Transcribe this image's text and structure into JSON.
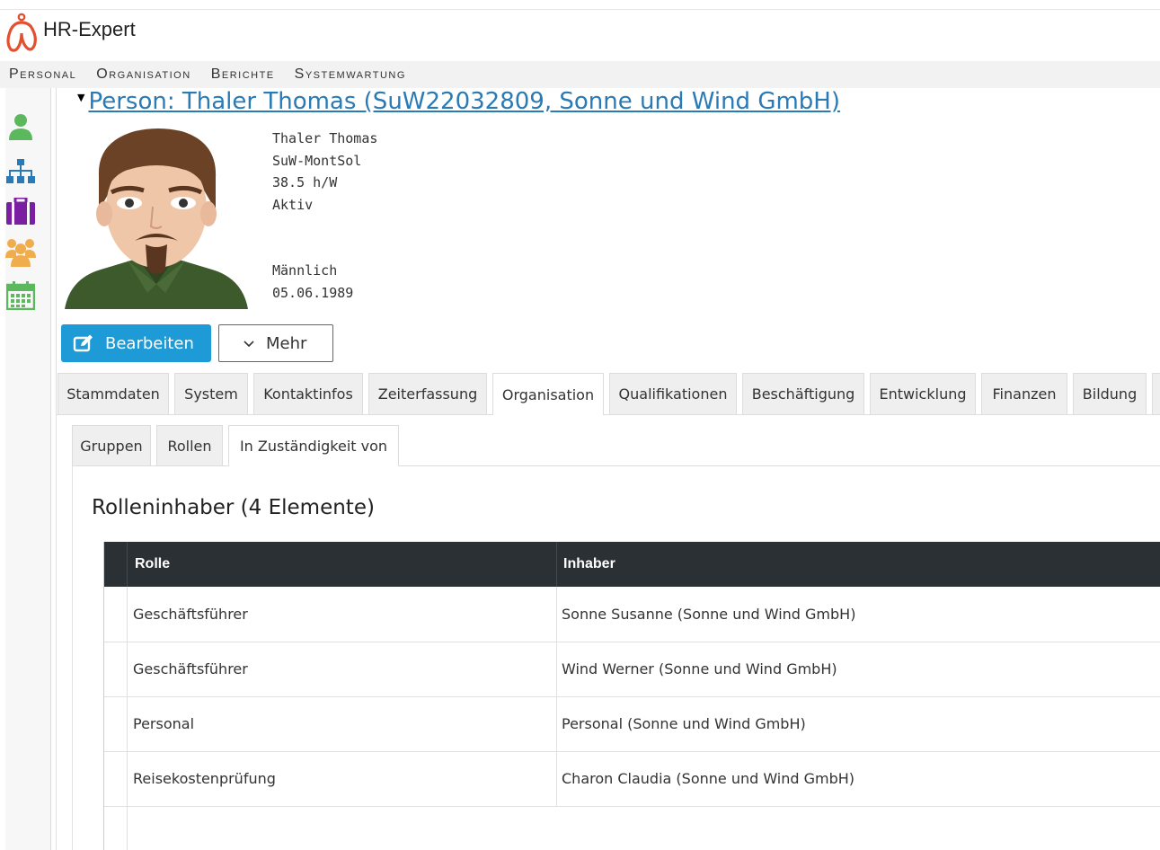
{
  "app": {
    "name": "HR-Expert"
  },
  "menu": [
    {
      "label": "Personal"
    },
    {
      "label": "Organisation"
    },
    {
      "label": "Berichte"
    },
    {
      "label": "Systemwartung"
    }
  ],
  "sidebar": {
    "icons": [
      {
        "name": "user-icon",
        "color": "#5cb85c"
      },
      {
        "name": "org-chart-icon",
        "color": "#2a7ab5"
      },
      {
        "name": "briefcase-icon",
        "color": "#7b1fa2"
      },
      {
        "name": "group-icon",
        "color": "#f0ad4e"
      },
      {
        "name": "calendar-icon",
        "color": "#5cb85c"
      }
    ]
  },
  "person": {
    "title": "Person: Thaler Thomas (SuW22032809, Sonne und Wind GmbH)",
    "name": "Thaler Thomas",
    "unit": "SuW-MontSol",
    "hours": "38.5 h/W",
    "status": "Aktiv",
    "gender": "Männlich",
    "birthdate": "05.06.1989"
  },
  "actions": {
    "edit_label": "Bearbeiten",
    "more_label": "Mehr"
  },
  "tabs": [
    {
      "label": "Stammdaten"
    },
    {
      "label": "System"
    },
    {
      "label": "Kontaktinfos"
    },
    {
      "label": "Zeiterfassung"
    },
    {
      "label": "Organisation",
      "active": true
    },
    {
      "label": "Qualifikationen"
    },
    {
      "label": "Beschäftigung"
    },
    {
      "label": "Entwicklung"
    },
    {
      "label": "Finanzen"
    },
    {
      "label": "Bildung"
    }
  ],
  "subtabs": [
    {
      "label": "Gruppen"
    },
    {
      "label": "Rollen"
    },
    {
      "label": "In Zuständigkeit von",
      "active": true
    }
  ],
  "section": {
    "heading": "Rolleninhaber (4 Elemente)"
  },
  "table": {
    "columns": [
      "Rolle",
      "Inhaber"
    ],
    "rows": [
      [
        "Geschäftsführer",
        "Sonne Susanne (Sonne und Wind GmbH)"
      ],
      [
        "Geschäftsführer",
        "Wind Werner (Sonne und Wind GmbH)"
      ],
      [
        "Personal",
        "Personal (Sonne und Wind GmbH)"
      ],
      [
        "Reisekostenprüfung",
        "Charon Claudia (Sonne und Wind GmbH)"
      ]
    ]
  },
  "colors": {
    "accent": "#1e9ad6",
    "link": "#2a7ab5",
    "grid_header": "#2b3035"
  }
}
